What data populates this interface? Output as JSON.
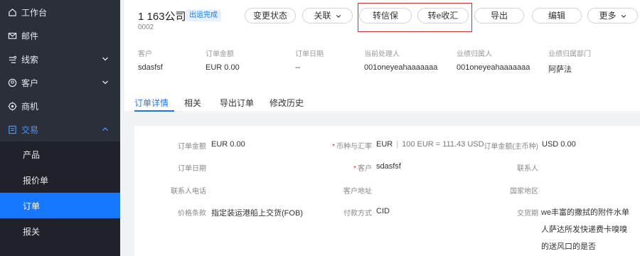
{
  "sidebar": {
    "items": [
      {
        "label": "工作台",
        "icon": "home-icon"
      },
      {
        "label": "邮件",
        "icon": "mail-icon"
      },
      {
        "label": "线索",
        "icon": "leads-icon"
      },
      {
        "label": "客户",
        "icon": "customer-icon"
      },
      {
        "label": "商机",
        "icon": "opportunity-icon"
      },
      {
        "label": "交易",
        "icon": "transaction-icon"
      }
    ],
    "sub_items": [
      {
        "label": "产品"
      },
      {
        "label": "报价单"
      },
      {
        "label": "订单"
      },
      {
        "label": "报关"
      }
    ]
  },
  "header": {
    "title": "1 163公司",
    "status": "出运完成",
    "code": "0002",
    "buttons": {
      "change_status": "变更状态",
      "related": "关联",
      "to_credit": "转信保",
      "to_ecollect": "转e收汇",
      "export": "导出",
      "edit": "编辑",
      "more": "更多"
    }
  },
  "summary": {
    "labels": [
      "客户",
      "订单金额",
      "订单日期",
      "当前处理人",
      "业绩归属人",
      "业绩归属部门"
    ],
    "values": [
      "sdasfsf",
      "EUR 0.00",
      "--",
      "001oneyeahaaaaaaa",
      "001oneyeahaaaaaaa",
      "阿萨法"
    ]
  },
  "tabs": [
    "订单详情",
    "相关",
    "导出订单",
    "修改历史"
  ],
  "details": {
    "order_amount_label": "订单金额",
    "order_amount_value": "EUR 0.00",
    "currency_rate_label": "币种与汇率",
    "currency_value": "EUR",
    "rate_value": "100 EUR = 111.43 USD",
    "order_amount_main_label": "订单金额(主币种)",
    "order_amount_main_value": "USD 0.00",
    "order_date_label": "订单日期",
    "customer_label": "客户",
    "customer_value": "sdasfsf",
    "contact_label": "联系人",
    "contact_phone_label": "联系人电话",
    "customer_address_label": "客户地址",
    "country_label": "国家地区",
    "price_terms_label": "价格条款",
    "price_terms_value": "指定装运港船上交货(FOB)",
    "payment_label": "付款方式",
    "payment_value": "CID",
    "shipping_label": "交货期",
    "shipping_lines": [
      "we丰富的撒拭的附件水单",
      "人萨达所发快递费卡嗅嗅",
      "的送风口的是否"
    ]
  },
  "colors": {
    "primary": "#1677ff",
    "sidebar_bg": "#2b2f3a",
    "highlight": "#e8262a"
  }
}
